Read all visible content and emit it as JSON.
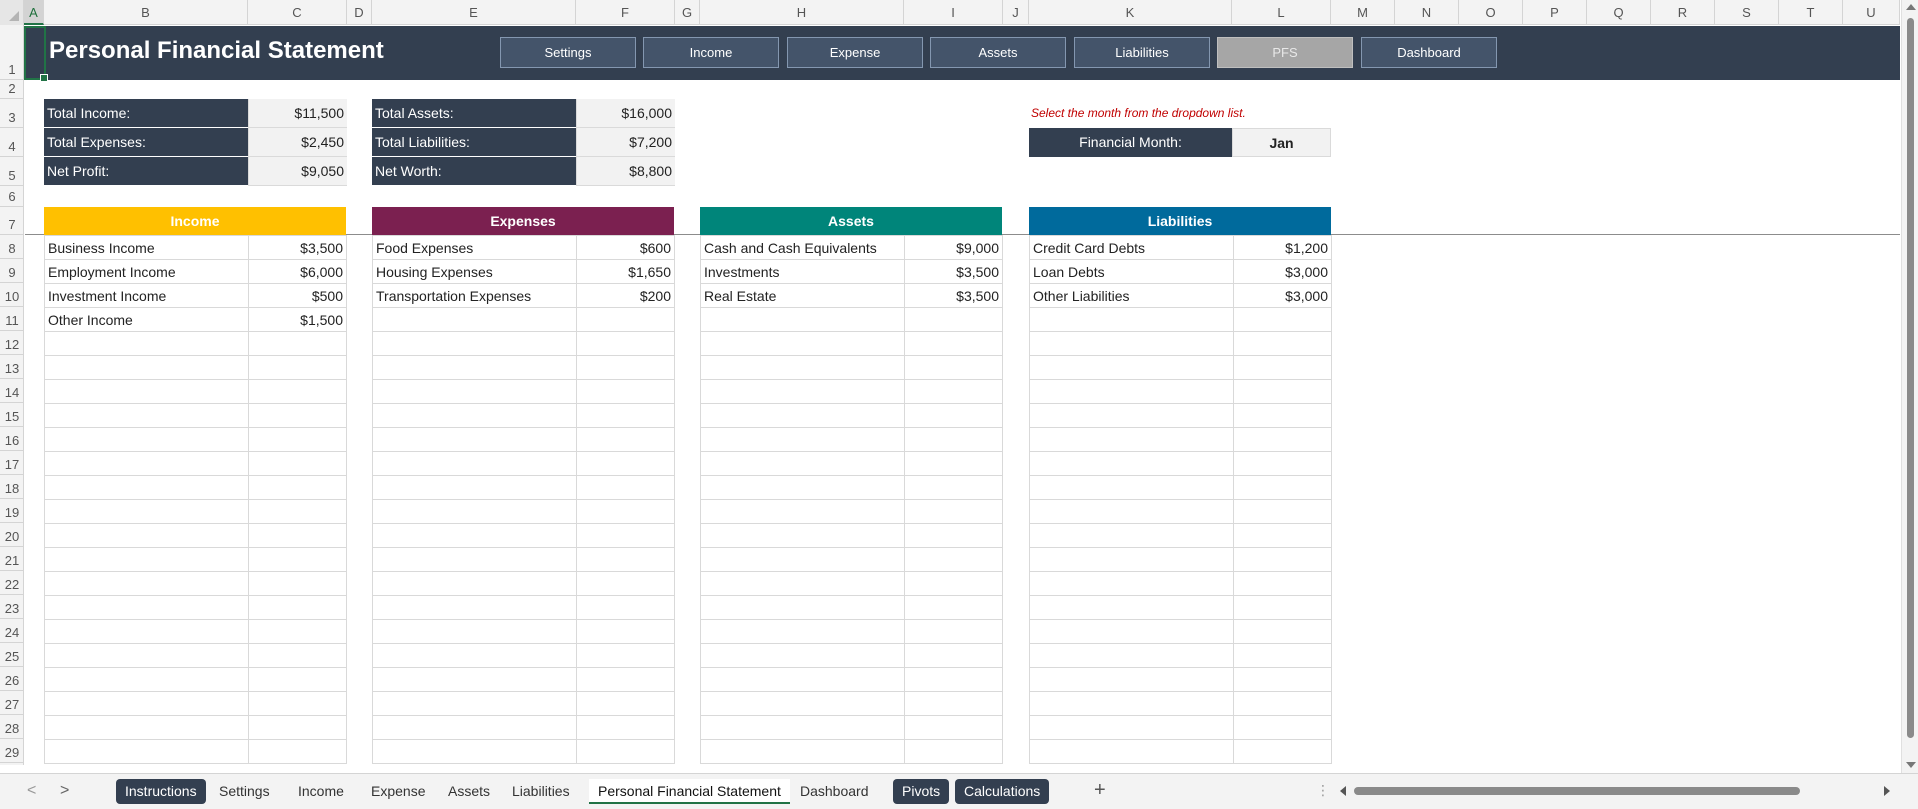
{
  "columns": [
    "A",
    "B",
    "C",
    "D",
    "E",
    "F",
    "G",
    "H",
    "I",
    "J",
    "K",
    "L",
    "M",
    "N",
    "O",
    "P",
    "Q",
    "R",
    "S",
    "T",
    "U"
  ],
  "rows": [
    "1",
    "2",
    "3",
    "4",
    "5",
    "6",
    "7",
    "8",
    "9",
    "10",
    "11",
    "12",
    "13",
    "14",
    "15",
    "16",
    "17",
    "18",
    "19",
    "20",
    "21",
    "22",
    "23",
    "24",
    "25",
    "26",
    "27",
    "28",
    "29"
  ],
  "title": "Personal Financial Statement",
  "nav": [
    "Settings",
    "Income",
    "Expense",
    "Assets",
    "Liabilities",
    "PFS",
    "Dashboard"
  ],
  "summary": {
    "total_income_label": "Total Income:",
    "total_income": "$11,500",
    "total_expenses_label": "Total Expenses:",
    "total_expenses": "$2,450",
    "net_profit_label": "Net Profit:",
    "net_profit": "$9,050",
    "total_assets_label": "Total Assets:",
    "total_assets": "$16,000",
    "total_liabilities_label": "Total Liabilities:",
    "total_liabilities": "$7,200",
    "net_worth_label": "Net Worth:",
    "net_worth": "$8,800"
  },
  "month": {
    "hint": "Select the month from the dropdown list.",
    "label": "Financial Month:",
    "value": "Jan"
  },
  "sections": [
    {
      "title": "Income",
      "color": "#ffc000",
      "rows": [
        [
          "Business Income",
          "$3,500"
        ],
        [
          "Employment Income",
          "$6,000"
        ],
        [
          "Investment Income",
          "$500"
        ],
        [
          "Other Income",
          "$1,500"
        ]
      ]
    },
    {
      "title": "Expenses",
      "color": "#7b2050",
      "rows": [
        [
          "Food Expenses",
          "$600"
        ],
        [
          "Housing Expenses",
          "$1,650"
        ],
        [
          "Transportation Expenses",
          "$200"
        ]
      ]
    },
    {
      "title": "Assets",
      "color": "#00857a",
      "rows": [
        [
          "Cash and Cash Equivalents",
          "$9,000"
        ],
        [
          "Investments",
          "$3,500"
        ],
        [
          "Real Estate",
          "$3,500"
        ]
      ]
    },
    {
      "title": "Liabilities",
      "color": "#006a9c",
      "rows": [
        [
          "Credit Card Debts",
          "$1,200"
        ],
        [
          "Loan Debts",
          "$3,000"
        ],
        [
          "Other Liabilities",
          "$3,000"
        ]
      ]
    }
  ],
  "sheet_tabs": [
    {
      "label": "Instructions",
      "style": "dark"
    },
    {
      "label": "Settings",
      "style": "plain"
    },
    {
      "label": "Income",
      "style": "plain"
    },
    {
      "label": "Expense",
      "style": "plain"
    },
    {
      "label": "Assets",
      "style": "plain"
    },
    {
      "label": "Liabilities",
      "style": "plain"
    },
    {
      "label": "Personal Financial Statement",
      "style": "active"
    },
    {
      "label": "Dashboard",
      "style": "plain"
    },
    {
      "label": "Pivots",
      "style": "dark"
    },
    {
      "label": "Calculations",
      "style": "dark"
    }
  ],
  "tab_nav": {
    "prev": "<",
    "next": ">",
    "add": "+",
    "more": "⋮"
  }
}
